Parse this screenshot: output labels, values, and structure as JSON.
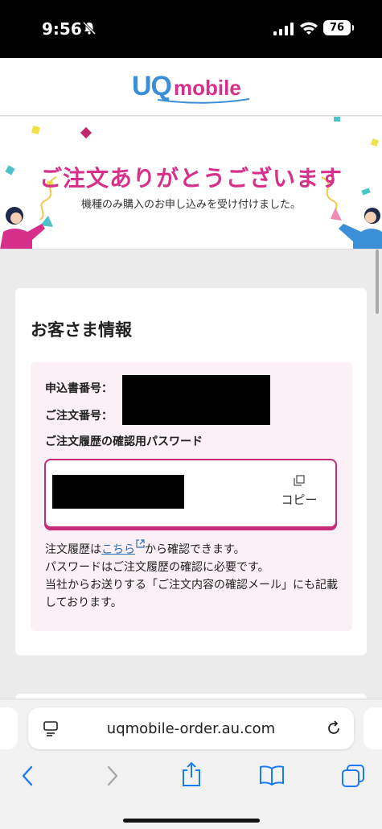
{
  "status_bar": {
    "time": "9:56",
    "battery": "76"
  },
  "header": {
    "logo_uq": "UQ",
    "logo_mobile": "mobile"
  },
  "banner": {
    "title": "ご注文ありがとうございます",
    "subtitle": "機種のみ購入のお申し込みを受け付けました。"
  },
  "customer_info": {
    "title": "お客さま情報",
    "application_number_label": "申込書番号：",
    "order_number_label": "ご注文番号：",
    "password_label": "ご注文履歴の確認用パスワード",
    "copy_label": "コピー",
    "note_prefix": "注文履歴は",
    "note_link": "こちら",
    "note_suffix": "から確認できます。",
    "note_line2": "パスワードはご注文履歴の確認に必要です。",
    "note_line3": "当社からお送りする「ご注文内容の確認メール」にも記載しております。"
  },
  "browser": {
    "url": "uqmobile-order.au.com"
  },
  "colors": {
    "brand_pink": "#d6308a",
    "brand_blue": "#3a8fd8",
    "link_blue": "#2a6fb8",
    "ios_blue": "#1a7cf5"
  }
}
